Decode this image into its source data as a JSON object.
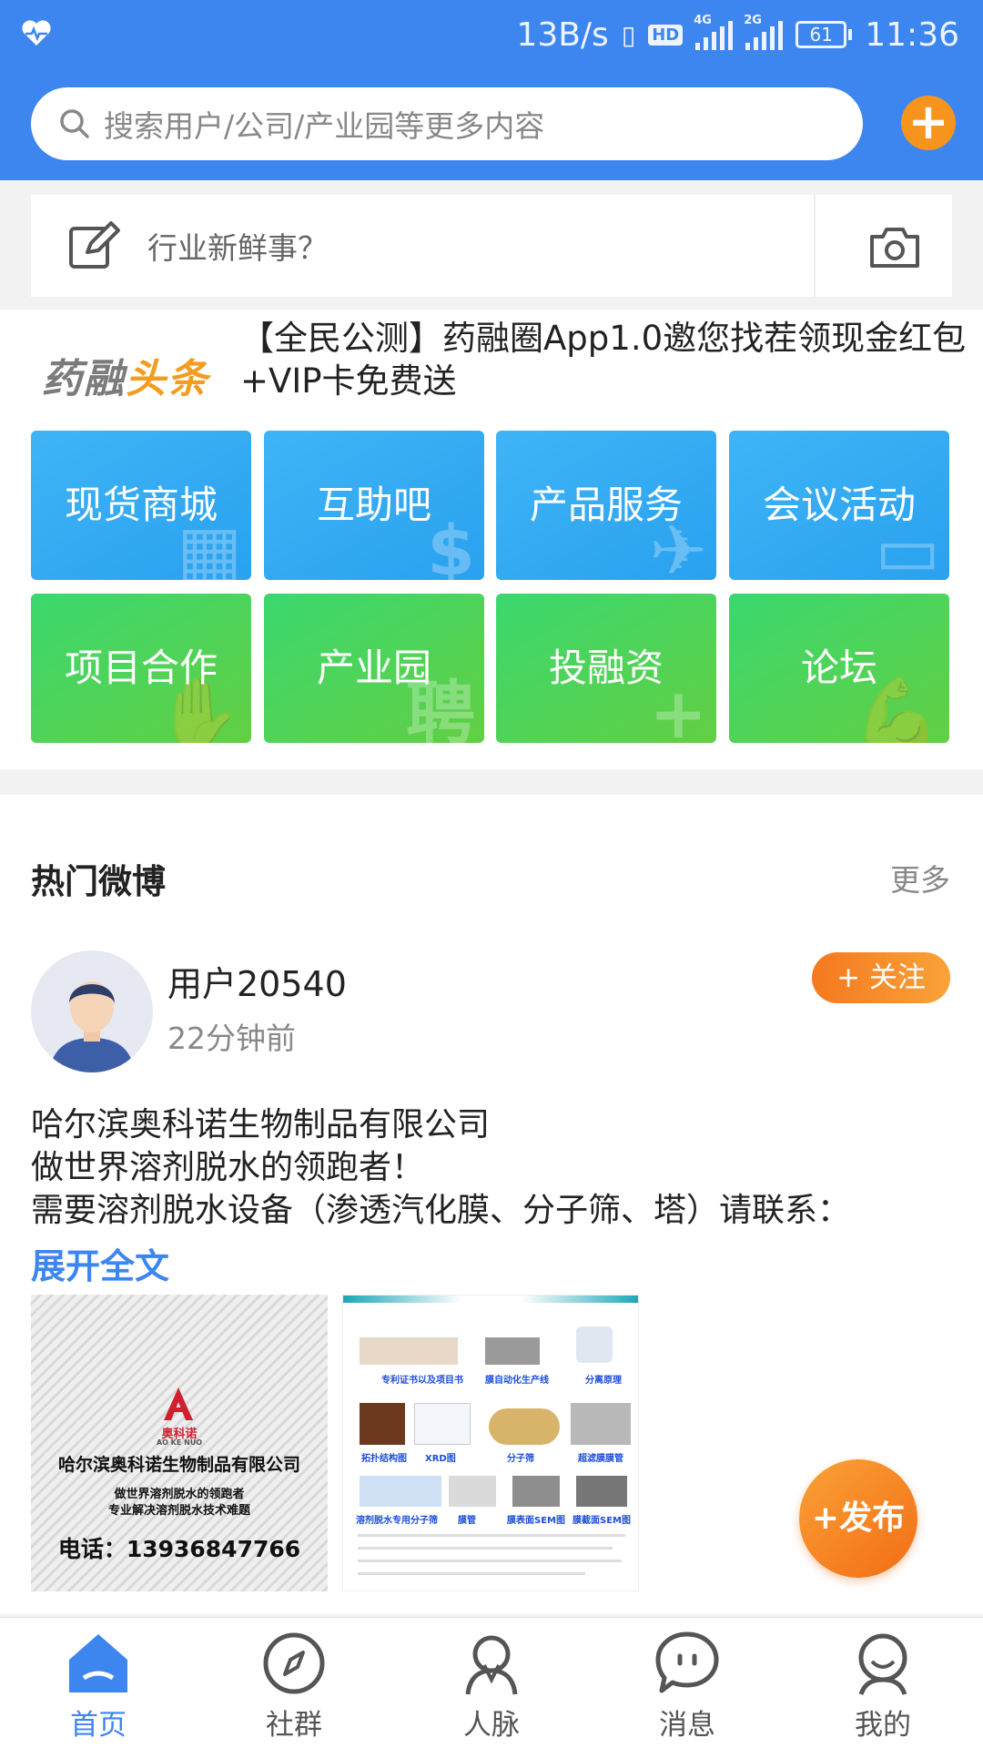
{
  "status_bar": {
    "network_speed": "13B/s",
    "hd_badge": "HD",
    "net1": "4G",
    "net2": "2G",
    "battery": "61",
    "time": "11:36"
  },
  "search": {
    "placeholder": "搜索用户/公司/产业园等更多内容"
  },
  "post_prompt": {
    "text": "行业新鲜事？"
  },
  "headline": {
    "logo_part1": "药融",
    "logo_part2": "头条",
    "text": "【全民公测】药融圈App1.0邀您找茬领现金红包+VIP卡免费送"
  },
  "tiles": [
    {
      "label": "现货商城",
      "deco": "▦"
    },
    {
      "label": "互助吧",
      "deco": "$"
    },
    {
      "label": "产品服务",
      "deco": "✈"
    },
    {
      "label": "会议活动",
      "deco": "▭"
    },
    {
      "label": "项目合作",
      "deco": "✋"
    },
    {
      "label": "产业园",
      "deco": "聘"
    },
    {
      "label": "投融资",
      "deco": "+"
    },
    {
      "label": "论坛",
      "deco": "💪"
    }
  ],
  "hot": {
    "title": "热门微博",
    "more": "更多"
  },
  "post": {
    "user": "用户20540",
    "time": "22分钟前",
    "follow": "+ 关注",
    "lines": [
      "哈尔滨奥科诺生物制品有限公司",
      "做世界溶剂脱水的领跑者！",
      "需要溶剂脱水设备（渗透汽化膜、分子筛、塔）请联系："
    ],
    "expand": "展开全文"
  },
  "image1": {
    "brand": "奥科诺",
    "brand_en": "AO KE NUO",
    "company": "哈尔滨奥科诺生物制品有限公司",
    "slogan1": "做世界溶剂脱水的领跑者",
    "slogan2": "专业解决溶剂脱水技术难题",
    "phone": "电话：13936847766"
  },
  "image2": {
    "captions": [
      "专利证书以及项目书",
      "膜自动化生产线",
      "分离原理",
      "拓扑结构图",
      "XRD图",
      "分子筛",
      "超滤膜膜管",
      "溶剂脱水专用分子筛",
      "膜管",
      "膜表面SEM图",
      "膜截面SEM图"
    ]
  },
  "publish": "+发布",
  "tabbar": [
    {
      "label": "首页",
      "active": true
    },
    {
      "label": "社群",
      "active": false
    },
    {
      "label": "人脉",
      "active": false
    },
    {
      "label": "消息",
      "active": false
    },
    {
      "label": "我的",
      "active": false
    }
  ],
  "colors": {
    "primary": "#3d86f0",
    "orange": "#f7941d",
    "tile_blue": "#2aa1ef",
    "tile_green": "#3bd86f"
  }
}
